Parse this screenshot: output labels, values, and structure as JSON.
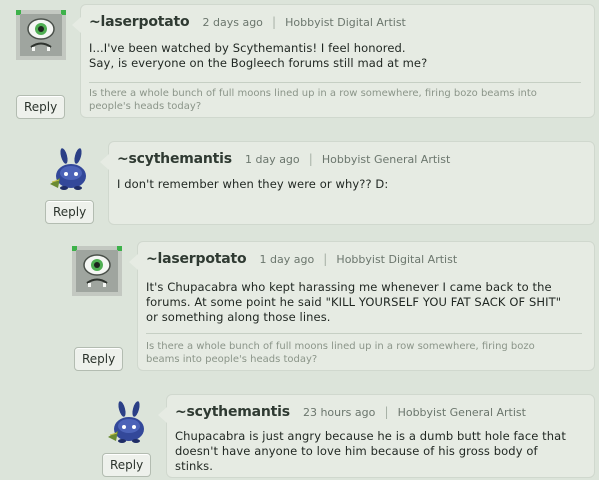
{
  "comments": [
    {
      "username": "~laserpotato",
      "time": "2 days ago",
      "role": "Hobbyist Digital Artist",
      "lines": [
        "I...I've been watched by Scythemantis! I feel honored.",
        "Say, is everyone on the Bogleech forums still mad at me?"
      ],
      "signature_lines": [
        "Is there a whole bunch of full moons lined up in a row somewhere, firing bozo beams into",
        "people's heads today?"
      ],
      "reply_label": "Reply",
      "avatar_icon": "cyclops-eye-icon"
    },
    {
      "username": "~scythemantis",
      "time": "1 day ago",
      "role": "Hobbyist General Artist",
      "lines": [
        "I don't remember when they were or why?? D:"
      ],
      "reply_label": "Reply",
      "avatar_icon": "blue-creature-icon"
    },
    {
      "username": "~laserpotato",
      "time": "1 day ago",
      "role": "Hobbyist Digital Artist",
      "lines": [
        "It's Chupacabra who kept harassing me whenever I came back to the",
        "forums. At some point he said \"KILL YOURSELF YOU FAT SACK OF SHIT\"",
        "or something along those lines."
      ],
      "signature_lines": [
        "Is there a whole bunch of full moons lined up in a row somewhere, firing bozo",
        "beams into people's heads today?"
      ],
      "reply_label": "Reply",
      "avatar_icon": "cyclops-eye-icon"
    },
    {
      "username": "~scythemantis",
      "time": "23 hours ago",
      "role": "Hobbyist General Artist",
      "lines": [
        "Chupacabra is just angry because he is a dumb butt hole face that",
        "doesn't have anyone to love him because of his gross body of",
        "stinks."
      ],
      "reply_label": "Reply",
      "avatar_icon": "blue-creature-icon"
    }
  ],
  "separator": "|"
}
